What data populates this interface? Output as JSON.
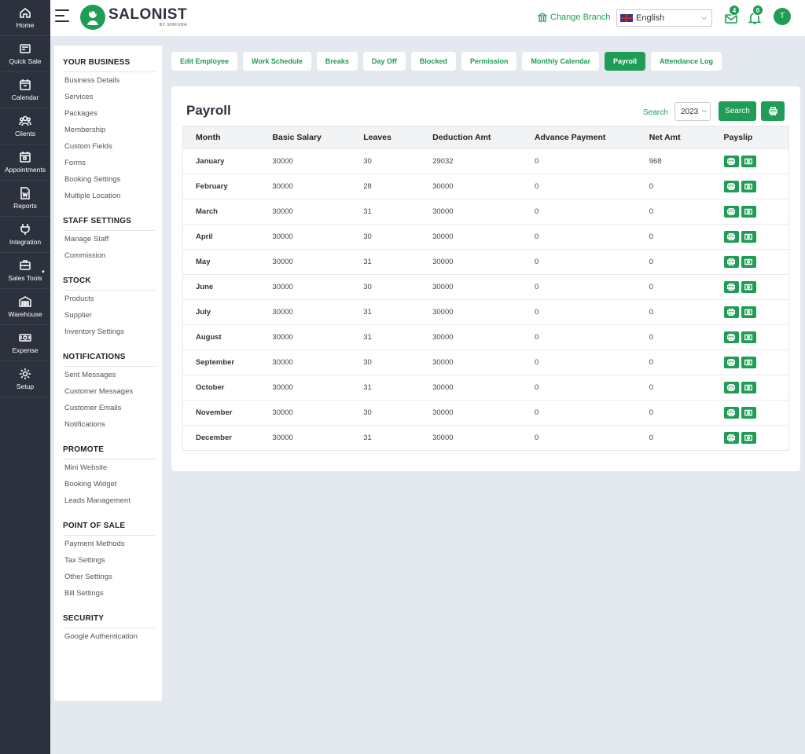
{
  "rail": [
    {
      "label": "Home",
      "icon": "home-icon"
    },
    {
      "label": "Quick Sale",
      "icon": "quick-sale-icon"
    },
    {
      "label": "Calendar",
      "icon": "calendar-icon"
    },
    {
      "label": "Clients",
      "icon": "clients-icon"
    },
    {
      "label": "Appointments",
      "icon": "appointments-icon"
    },
    {
      "label": "Reports",
      "icon": "reports-icon"
    },
    {
      "label": "Integration",
      "icon": "plug-icon"
    },
    {
      "label": "Sales Tools",
      "icon": "briefcase-icon"
    },
    {
      "label": "Warehouse",
      "icon": "warehouse-icon"
    },
    {
      "label": "Expense",
      "icon": "cash-icon"
    },
    {
      "label": "Setup",
      "icon": "gear-icon"
    }
  ],
  "header": {
    "logo_main": "SALONIST",
    "logo_sub": "BY SHRIVRA",
    "change_branch": "Change Branch",
    "language": "English",
    "mail_count": "4",
    "notif_count": "0",
    "avatar_initial": "T",
    "brand_color": "#1f9d55"
  },
  "settings": [
    {
      "title": "YOUR BUSINESS",
      "links": [
        "Business Details",
        "Services",
        "Packages",
        "Membership",
        "Custom Fields",
        "Forms",
        "Booking Settings",
        "Multiple Location"
      ]
    },
    {
      "title": "STAFF SETTINGS",
      "links": [
        "Manage Staff",
        "Commission"
      ]
    },
    {
      "title": "STOCK",
      "links": [
        "Products",
        "Supplier",
        "Inventory Settings"
      ]
    },
    {
      "title": "NOTIFICATIONS",
      "links": [
        "Sent Messages",
        "Customer Messages",
        "Customer Emails",
        "Notifications"
      ]
    },
    {
      "title": "PROMOTE",
      "links": [
        "Mini Website",
        "Booking Widget",
        "Leads Management"
      ]
    },
    {
      "title": "POINT OF SALE",
      "links": [
        "Payment Methods",
        "Tax Settings",
        "Other Settings",
        "Bill Settings"
      ]
    },
    {
      "title": "SECURITY",
      "links": [
        "Google Authentication"
      ]
    }
  ],
  "tabs": [
    {
      "label": "Edit Employee",
      "active": false
    },
    {
      "label": "Work Schedule",
      "active": false
    },
    {
      "label": "Breaks",
      "active": false
    },
    {
      "label": "Day Off",
      "active": false
    },
    {
      "label": "Blocked",
      "active": false
    },
    {
      "label": "Permission",
      "active": false
    },
    {
      "label": "Monthly Calendar",
      "active": false
    },
    {
      "label": "Payroll",
      "active": true
    },
    {
      "label": "Attendance Log",
      "active": false
    }
  ],
  "payroll": {
    "title": "Payroll",
    "search_label": "Search",
    "year": "2023",
    "search_button": "Search",
    "columns": [
      "Month",
      "Basic Salary",
      "Leaves",
      "Deduction Amt",
      "Advance Payment",
      "Net Amt",
      "Payslip"
    ],
    "rows": [
      [
        "January",
        "30000",
        "30",
        "29032",
        "0",
        "968"
      ],
      [
        "February",
        "30000",
        "28",
        "30000",
        "0",
        "0"
      ],
      [
        "March",
        "30000",
        "31",
        "30000",
        "0",
        "0"
      ],
      [
        "April",
        "30000",
        "30",
        "30000",
        "0",
        "0"
      ],
      [
        "May",
        "30000",
        "31",
        "30000",
        "0",
        "0"
      ],
      [
        "June",
        "30000",
        "30",
        "30000",
        "0",
        "0"
      ],
      [
        "July",
        "30000",
        "31",
        "30000",
        "0",
        "0"
      ],
      [
        "August",
        "30000",
        "31",
        "30000",
        "0",
        "0"
      ],
      [
        "September",
        "30000",
        "30",
        "30000",
        "0",
        "0"
      ],
      [
        "October",
        "30000",
        "31",
        "30000",
        "0",
        "0"
      ],
      [
        "November",
        "30000",
        "30",
        "30000",
        "0",
        "0"
      ],
      [
        "December",
        "30000",
        "31",
        "30000",
        "0",
        "0"
      ]
    ]
  }
}
